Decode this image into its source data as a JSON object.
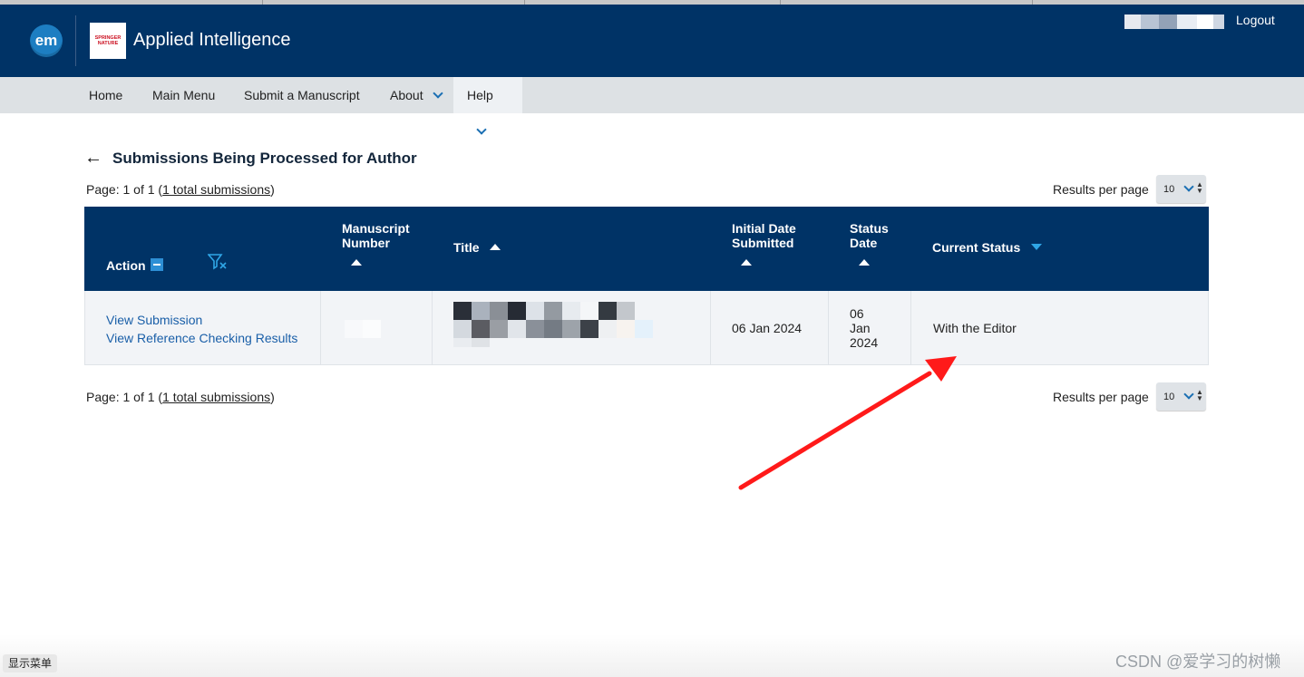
{
  "header": {
    "em_logo_text": "em",
    "publisher_logo_line1": "SPRINGER",
    "publisher_logo_line2": "NATURE",
    "journal_title": "Applied Intelligence",
    "logout_label": "Logout"
  },
  "nav": {
    "items": [
      {
        "label": "Home"
      },
      {
        "label": "Main Menu"
      },
      {
        "label": "Submit a Manuscript"
      },
      {
        "label": "About"
      },
      {
        "label": "Help"
      }
    ]
  },
  "page": {
    "title": "Submissions Being Processed for Author",
    "page_info_prefix": "Page: 1 of 1 (",
    "page_info_link": "1 total submissions",
    "page_info_suffix": ")",
    "results_per_page_label": "Results per page",
    "results_per_page_value": "10"
  },
  "table": {
    "headers": {
      "action": "Action",
      "manuscript_number_line1": "Manuscript",
      "manuscript_number_line2": "Number",
      "title": "Title",
      "initial_date_line1": "Initial Date",
      "initial_date_line2": "Submitted",
      "status_date_line1": "Status",
      "status_date_line2": "Date",
      "current_status": "Current Status"
    },
    "rows": [
      {
        "action_links": [
          "View Submission",
          "View Reference Checking Results"
        ],
        "initial_date_submitted": "06 Jan 2024",
        "status_date_line1": "06",
        "status_date_line2": "Jan",
        "status_date_line3": "2024",
        "current_status": "With the Editor"
      }
    ]
  },
  "footer": {
    "menu_toggle_label": "显示菜单",
    "watermark": "CSDN @爱学习的树懒"
  },
  "colors": {
    "header_bg": "#003366",
    "nav_bg": "#dde1e4",
    "link": "#1a5fa8",
    "accent": "#2d8fd5",
    "annotation_arrow": "#ff1a1a"
  },
  "icons": [
    "back-arrow-icon",
    "chevron-down-icon",
    "filter-clear-icon",
    "sort-ascending-icon",
    "sort-descending-icon",
    "collapse-minus-icon"
  ]
}
